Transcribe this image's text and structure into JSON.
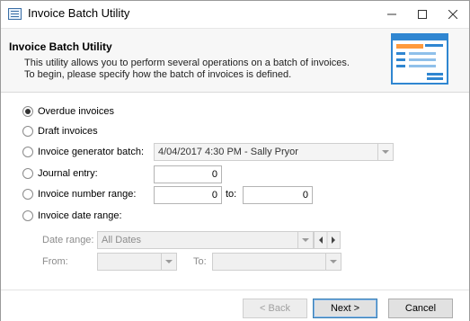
{
  "window": {
    "title": "Invoice Batch Utility"
  },
  "header": {
    "title": "Invoice Batch Utility",
    "desc_line1": "This utility allows you to perform several operations on a batch of invoices.",
    "desc_line2": "To begin, please specify how the batch of invoices is defined."
  },
  "options": {
    "overdue": "Overdue invoices",
    "draft": "Draft invoices",
    "generator": "Invoice generator batch:",
    "journal": "Journal entry:",
    "number_range": "Invoice number range:",
    "date_range": "Invoice date range:",
    "selected": "overdue"
  },
  "fields": {
    "generator_value": "4/04/2017 4:30 PM - Sally Pryor",
    "journal_value": "0",
    "number_from": "0",
    "to_label": "to:",
    "number_to": "0",
    "date_range_label": "Date range:",
    "date_range_value": "All Dates",
    "from_label": "From:",
    "from_value": "",
    "date_to_label": "To:",
    "date_to_value": ""
  },
  "footer": {
    "back": "< Back",
    "next": "Next >",
    "cancel": "Cancel"
  }
}
